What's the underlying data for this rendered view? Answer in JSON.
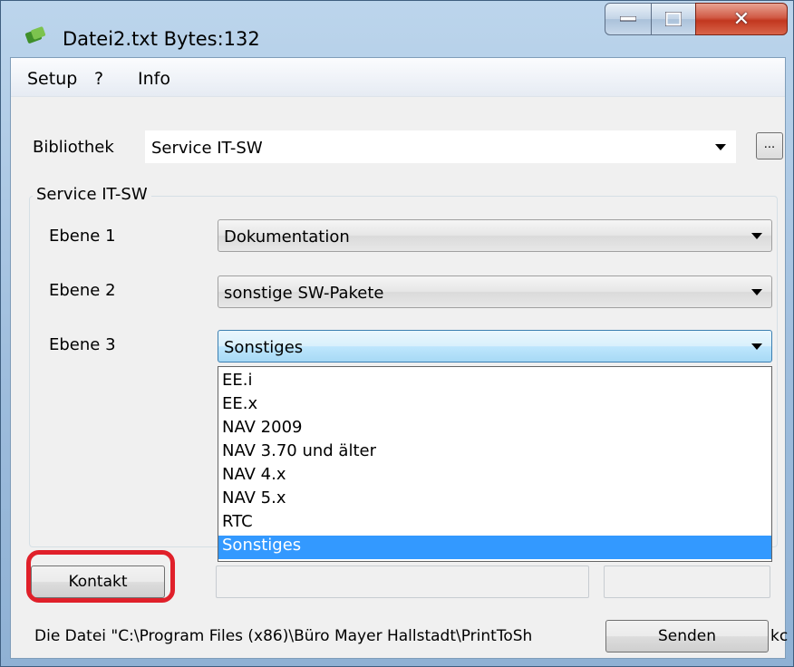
{
  "window": {
    "title": "Datei2.txt Bytes:132"
  },
  "menu": {
    "items": [
      "Setup",
      "?",
      "Info"
    ]
  },
  "library": {
    "label": "Bibliothek",
    "value": "Service IT-SW",
    "browse_label": "..."
  },
  "group": {
    "title": "Service IT-SW",
    "levels": [
      {
        "label": "Ebene 1",
        "value": "Dokumentation"
      },
      {
        "label": "Ebene 2",
        "value": "sonstige SW-Pakete"
      },
      {
        "label": "Ebene 3",
        "value": "Sonstiges"
      }
    ]
  },
  "dropdown": {
    "options": [
      "EE.i",
      "EE.x",
      "NAV 2009",
      "NAV 3.70 und älter",
      "NAV 4.x",
      "NAV 5.x",
      "RTC",
      "Sonstiges"
    ],
    "selected": "Sonstiges"
  },
  "buttons": {
    "contact": "Kontakt",
    "send": "Senden"
  },
  "status": {
    "text": "Die Datei \"C:\\Program Files (x86)\\Büro Mayer Hallstadt\\PrintToSh",
    "tail": "kc"
  },
  "colors": {
    "selection": "#3399ff",
    "highlight": "#e0202a"
  }
}
